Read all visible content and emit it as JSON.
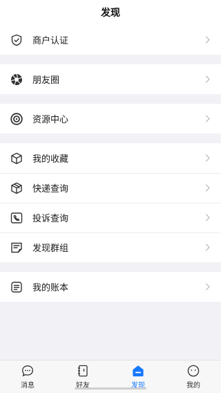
{
  "header": {
    "title": "发现"
  },
  "groups": [
    {
      "items": [
        {
          "label": "商户认证",
          "icon": "shield-check-icon"
        }
      ]
    },
    {
      "items": [
        {
          "label": "朋友圈",
          "icon": "aperture-icon"
        }
      ]
    },
    {
      "items": [
        {
          "label": "资源中心",
          "icon": "target-icon"
        }
      ]
    },
    {
      "items": [
        {
          "label": "我的收藏",
          "icon": "cube-icon"
        },
        {
          "label": "快递查询",
          "icon": "package-icon"
        },
        {
          "label": "投诉查询",
          "icon": "phone-complaint-icon"
        },
        {
          "label": "发现群组",
          "icon": "group-list-icon"
        }
      ]
    },
    {
      "items": [
        {
          "label": "我的账本",
          "icon": "ledger-icon"
        }
      ]
    }
  ],
  "tabbar": {
    "tabs": [
      {
        "label": "消息",
        "icon": "chat-bubble-icon",
        "active": false
      },
      {
        "label": "好友",
        "icon": "contacts-book-icon",
        "active": false
      },
      {
        "label": "发现",
        "icon": "discover-icon",
        "active": true
      },
      {
        "label": "我的",
        "icon": "face-icon",
        "active": false
      }
    ]
  },
  "colors": {
    "accent": "#1677ff",
    "background": "#f2f2f6",
    "icon": "#333333",
    "chevron": "#b5b5b5"
  }
}
